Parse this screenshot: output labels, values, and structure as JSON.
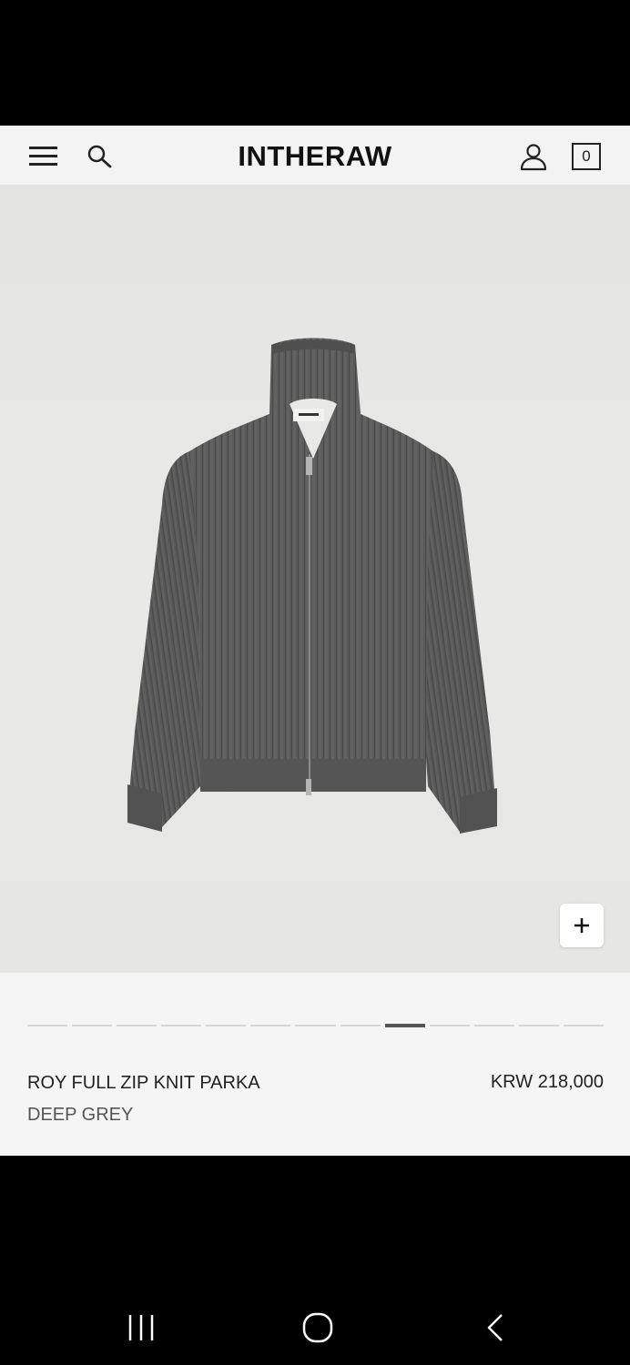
{
  "header": {
    "logo": "INTHERAW",
    "cart_count": "0",
    "icons": [
      "menu-icon",
      "search-icon",
      "account-icon",
      "cart-icon"
    ]
  },
  "gallery": {
    "image": "deep-grey-ribbed-full-zip-knit-jacket",
    "zoom_icon": "plus-icon",
    "slide_count": 13,
    "active_slide": 9
  },
  "product": {
    "name": "ROY FULL ZIP KNIT PARKA",
    "color": "DEEP GREY",
    "price": "KRW 218,000"
  },
  "system_nav": {
    "icons": [
      "recent-apps-icon",
      "home-icon",
      "back-icon"
    ]
  }
}
